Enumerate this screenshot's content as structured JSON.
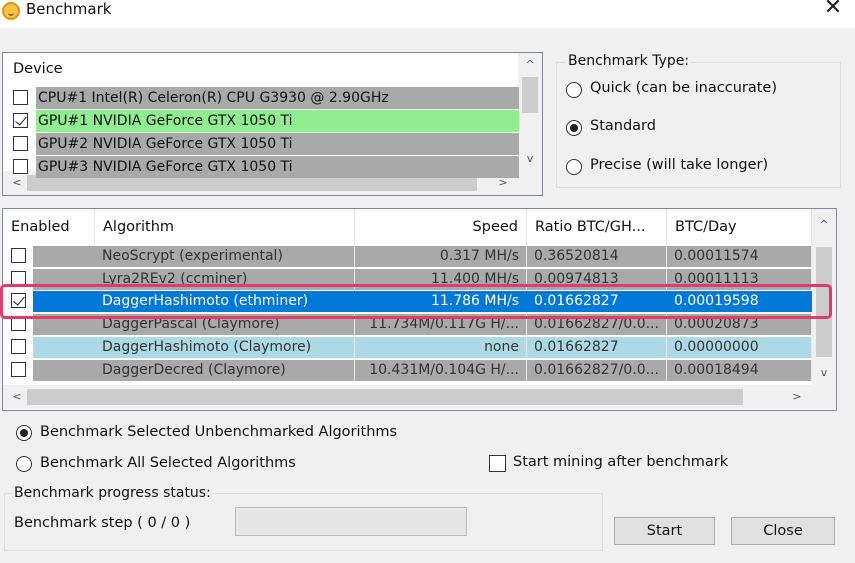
{
  "window": {
    "title": "Benchmark",
    "close_symbol": "✕"
  },
  "devices": {
    "header": "Device",
    "items": [
      {
        "label": "CPU#1 Intel(R) Celeron(R) CPU G3930 @ 2.90GHz",
        "checked": false,
        "bg": "#a9a9a9"
      },
      {
        "label": "GPU#1 NVIDIA GeForce GTX 1050 Ti",
        "checked": true,
        "bg": "#90ee90"
      },
      {
        "label": "GPU#2 NVIDIA GeForce GTX 1050 Ti",
        "checked": false,
        "bg": "#a9a9a9"
      },
      {
        "label": "GPU#3 NVIDIA GeForce GTX 1050 Ti",
        "checked": false,
        "bg": "#a9a9a9"
      }
    ],
    "scroll_up": "^",
    "scroll_down": "v",
    "scroll_left": "<",
    "scroll_right": ">"
  },
  "benchmark_type": {
    "label": "Benchmark Type:",
    "options": [
      {
        "label": "Quick (can be inaccurate)",
        "selected": false
      },
      {
        "label": "Standard",
        "selected": true
      },
      {
        "label": "Precise (will take longer)",
        "selected": false
      }
    ]
  },
  "algorithms": {
    "columns": [
      "Enabled",
      "Algorithm",
      "Speed",
      "Ratio BTC/GH...",
      "BTC/Day"
    ],
    "rows": [
      {
        "enabled": false,
        "algorithm": "NeoScrypt (experimental)",
        "speed": "0.317 MH/s",
        "ratio": "0.36520814",
        "btc_day": "0.00011574",
        "bg": "#a9a9a9",
        "selected": false
      },
      {
        "enabled": false,
        "algorithm": "Lyra2REv2 (ccminer)",
        "speed": "11.400 MH/s",
        "ratio": "0.00974813",
        "btc_day": "0.00011113",
        "bg": "#a9a9a9",
        "selected": false
      },
      {
        "enabled": true,
        "algorithm": "DaggerHashimoto (ethminer)",
        "speed": "11.786 MH/s",
        "ratio": "0.01662827",
        "btc_day": "0.00019598",
        "bg": "#0078d7",
        "selected": true
      },
      {
        "enabled": false,
        "algorithm": "DaggerPascal (Claymore)",
        "speed": "11.734M/0.117G H/...",
        "ratio": "0.01662827/0.0...",
        "btc_day": "0.00020873",
        "bg": "#a9a9a9",
        "selected": false
      },
      {
        "enabled": false,
        "algorithm": "DaggerHashimoto (Claymore)",
        "speed": "none",
        "ratio": "0.01662827",
        "btc_day": "0.00000000",
        "bg": "#add8e6",
        "selected": false
      },
      {
        "enabled": false,
        "algorithm": "DaggerDecred (Claymore)",
        "speed": "10.431M/0.104G H/...",
        "ratio": "0.01662827/0.0...",
        "btc_day": "0.00018494",
        "bg": "#a9a9a9",
        "selected": false
      }
    ],
    "scroll_up": "^",
    "scroll_down": "v",
    "scroll_left": "<",
    "scroll_right": ">",
    "highlight_color": "#e03a6e"
  },
  "options": {
    "unbenchmarked": {
      "label": "Benchmark Selected Unbenchmarked Algorithms",
      "selected": true
    },
    "all_selected": {
      "label": "Benchmark All Selected Algorithms",
      "selected": false
    },
    "start_mining": {
      "label": "Start mining after benchmark",
      "checked": false
    }
  },
  "progress": {
    "group_label": "Benchmark progress status:",
    "step_label": "Benchmark step ( 0 / 0 )",
    "value": 0
  },
  "buttons": {
    "start": "Start",
    "close": "Close"
  }
}
